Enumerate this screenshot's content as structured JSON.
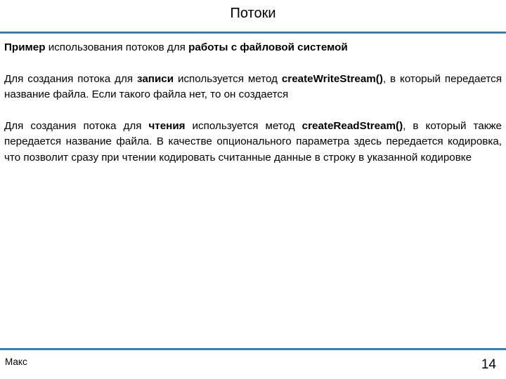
{
  "slide": {
    "title": "Потоки",
    "accent_color": "#1f72ad",
    "background_color": "#ffffff",
    "text_color": "#000000"
  },
  "body": {
    "paragraph_1": {
      "run_1_bold": "Пример",
      "run_2": " использования потоков для ",
      "run_3_bold": "работы с файловой системой"
    },
    "paragraph_2": {
      "run_1": "Для создания потока для ",
      "run_2_bold": "записи",
      "run_3": " используется метод ",
      "run_4_bold": "createWriteStream()",
      "run_5": ", в который передается название файла. Если такого файла нет, то он создается"
    },
    "paragraph_3": {
      "run_1": "Для создания потока для ",
      "run_2_bold": "чтения",
      "run_3": " используется метод ",
      "run_4_bold": "createReadStream()",
      "run_5": ", в который также передается название файла. В качестве опционального параметра здесь передается кодировка, что позволит сразу при чтении кодировать считанные данные в строку в указанной кодировке"
    }
  },
  "footer": {
    "author": "Макс",
    "page_number": "14"
  }
}
